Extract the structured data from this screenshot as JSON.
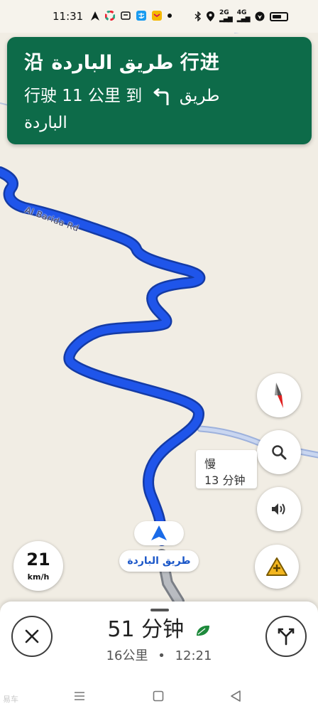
{
  "status_bar": {
    "time": "11:31",
    "left_icons": [
      "navigation-arrow-icon",
      "colorful-app-icon",
      "taobao-icon",
      "alipay-icon",
      "mail-icon",
      "dot-icon"
    ],
    "right_icons": [
      "bluetooth-icon",
      "location-icon",
      "signal-2g-icon",
      "signal-4g-icon",
      "vpn-icon",
      "battery-icon"
    ],
    "signal_2g": "2G",
    "signal_4g": "4G"
  },
  "direction_banner": {
    "title": "沿 طريق الباردة 行进",
    "subtitle_prefix": "行驶 11 公里 到",
    "subtitle_road": "طريق الباردة",
    "background_color": "#0d6b49"
  },
  "map": {
    "road_label": "Al Barida Rd",
    "traffic_label": {
      "line1": "慢",
      "line2": "13 分钟"
    },
    "current_road": "طريق الباردة",
    "route_color": "#1a52e6"
  },
  "controls": {
    "compass": "compass-icon",
    "search": "search-icon",
    "sound": "volume-icon",
    "report": "add-report-icon"
  },
  "speedometer": {
    "value": "21",
    "unit": "km/h"
  },
  "trip_sheet": {
    "eta_duration": "51 分钟",
    "distance": "16公里",
    "separator": "•",
    "arrival_time": "12:21"
  },
  "watermark": "易车"
}
